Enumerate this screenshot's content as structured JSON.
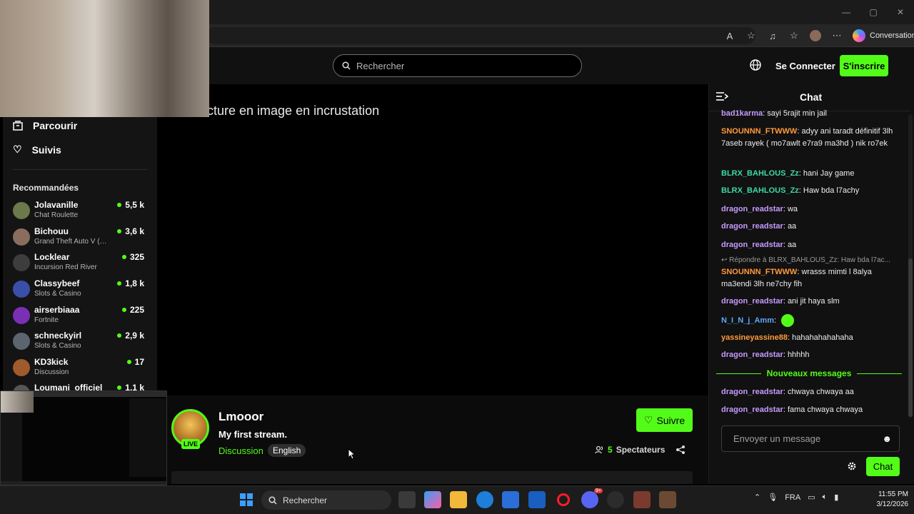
{
  "browser": {
    "conversation_label": "Conversation",
    "window_controls": [
      "—",
      "▢",
      "✕"
    ]
  },
  "header": {
    "search_placeholder": "Rechercher",
    "login_label": "Se Connecter",
    "signup_label": "S'inscrire"
  },
  "sidebar": {
    "nav": [
      {
        "label": "Parcourir",
        "icon": "browse-icon"
      },
      {
        "label": "Suivis",
        "icon": "heart-icon"
      }
    ],
    "recommended_title": "Recommandées",
    "channels": [
      {
        "name": "Jolavanille",
        "category": "Chat Roulette",
        "viewers": "5,5 k",
        "avatar_color": "#6b7a4a"
      },
      {
        "name": "Bichouu",
        "category": "Grand Theft Auto V (…",
        "viewers": "3,6 k",
        "avatar_color": "#8a6d5c"
      },
      {
        "name": "Locklear",
        "category": "Incursion Red River",
        "viewers": "325",
        "avatar_color": "#3d3d3d"
      },
      {
        "name": "Classybeef",
        "category": "Slots & Casino",
        "viewers": "1,8 k",
        "avatar_color": "#3a4fa8"
      },
      {
        "name": "airserbiaaa",
        "category": "Fortnite",
        "viewers": "225",
        "avatar_color": "#7b2fb5"
      },
      {
        "name": "schneckyirl",
        "category": "Slots & Casino",
        "viewers": "2,9 k",
        "avatar_color": "#5c6470"
      },
      {
        "name": "KD3kick",
        "category": "Discussion",
        "viewers": "17",
        "avatar_color": "#a05a2c"
      },
      {
        "name": "Loumani_officiel",
        "category": "",
        "viewers": "1,1 k",
        "avatar_color": "#555555"
      }
    ]
  },
  "player": {
    "pip_text": "cture en image en incrustation"
  },
  "stream": {
    "streamer": "Lmooor",
    "title": "My first stream.",
    "category": "Discussion",
    "language": "English",
    "live_label": "LIVE",
    "follow_label": "Suivre",
    "viewers_count": "5",
    "viewers_label": "Spectateurs"
  },
  "chat": {
    "title": "Chat",
    "messages": [
      {
        "user": "bad1karma",
        "color": "#c59bff",
        "text": "sayi 5rajit min jail"
      },
      {
        "user": "SNOUNNN_FTWWW",
        "color": "#ff9a3c",
        "text": "adyy ani taradt définitif 3lh 7aseb rayek ( mo7awlt e7ra9 ma3hd ) nik ro7ek"
      },
      {
        "user": "BLRX_BAHLOUS_Zz",
        "color": "#3fd9a3",
        "text": "hani Jay game"
      },
      {
        "user": "BLRX_BAHLOUS_Zz",
        "color": "#3fd9a3",
        "text": "Haw bda l7achy"
      },
      {
        "user": "dragon_readstar",
        "color": "#c59bff",
        "text": "wa"
      },
      {
        "user": "dragon_readstar",
        "color": "#c59bff",
        "text": "aa"
      },
      {
        "user": "dragon_readstar",
        "color": "#c59bff",
        "text": "aa"
      },
      {
        "user": "SNOUNNN_FTWWW",
        "color": "#ff9a3c",
        "text": "wrasss mimti l 8alya ma3endi 3lh ne7chy fih"
      },
      {
        "user": "dragon_readstar",
        "color": "#c59bff",
        "text": "ani jit haya slm"
      },
      {
        "user": "N_I_N_j_Amm",
        "color": "#5fa8ff",
        "text": ""
      },
      {
        "user": "yassineyassine88",
        "color": "#ff9a3c",
        "text": "hahahahahahaha"
      },
      {
        "user": "dragon_readstar",
        "color": "#c59bff",
        "text": "hhhhh"
      },
      {
        "user": "dragon_readstar",
        "color": "#c59bff",
        "text": "chwaya chwaya aa"
      },
      {
        "user": "dragon_readstar",
        "color": "#c59bff",
        "text": "fama chwaya chwaya"
      }
    ],
    "reply_text": "Répondre à BLRX_BAHLOUS_Zz: Haw bda l7ac...",
    "new_messages_label": "Nouveaux messages",
    "input_placeholder": "Envoyer un message",
    "send_label": "Chat"
  },
  "taskbar": {
    "search_label": "Rechercher",
    "language": "FRA",
    "time": "11:55 PM",
    "date": "3/12/2026",
    "discord_badge": "9+"
  },
  "colors": {
    "accent": "#53fc18",
    "background": "#000000",
    "panel": "#111111"
  }
}
